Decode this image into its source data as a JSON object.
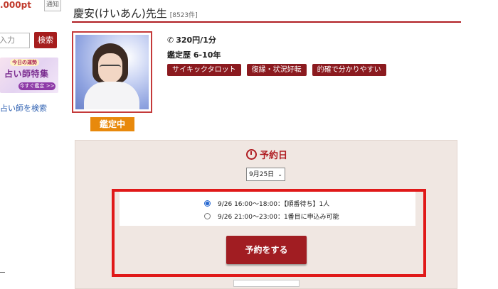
{
  "sidebar": {
    "points": ".000pt",
    "notify_label": "通知",
    "search_placeholder": "入力",
    "search_button": "検索",
    "banner": {
      "tag": "今日の運勢",
      "title": "占い師特集",
      "cta": "今すぐ鑑定 >>"
    },
    "search_link": "占い師を検索"
  },
  "header": {
    "name": "慶安(けいあん)先生",
    "review_count": "[8523件]"
  },
  "profile": {
    "status": "鑑定中",
    "price": "320円/1分",
    "experience": "鑑定歴 6-10年",
    "tags": [
      "サイキックタロット",
      "復縁・状況好転",
      "的確で分かりやすい"
    ]
  },
  "reservation": {
    "title": "予約日",
    "selected_date": "9月25日",
    "slots": [
      {
        "label": "9/26 16:00～18:00：【順番待ち】1人",
        "selected": true
      },
      {
        "label": "9/26 21:00～23:00：1番目に申込み可能",
        "selected": false
      }
    ],
    "button_label": "予約をする"
  },
  "colors": {
    "accent_red": "#b01e23",
    "button_red": "#a11d22",
    "tag_bg": "#8b1a1f",
    "status_orange": "#e8890c",
    "highlight": "#e01919"
  }
}
